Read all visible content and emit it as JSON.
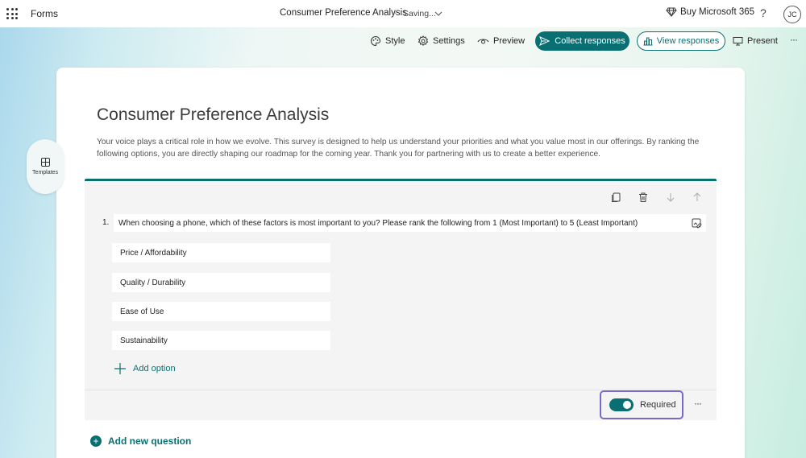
{
  "app": {
    "name": "Forms"
  },
  "document": {
    "title": "Consumer Preference Analysis",
    "separator": "-",
    "status": "Saving..."
  },
  "header": {
    "buy_label": "Buy Microsoft 365",
    "help_label": "?",
    "avatar_initials": "JC"
  },
  "toolbar": {
    "style_label": "Style",
    "settings_label": "Settings",
    "preview_label": "Preview",
    "collect_label": "Collect responses",
    "view_label": "View responses",
    "present_label": "Present",
    "more_label": "···"
  },
  "sidebar": {
    "templates_label": "Templates"
  },
  "form": {
    "title": "Consumer Preference Analysis",
    "description": "Your voice plays a critical role in how we evolve. This survey is designed to help us understand your priorities and what you value most in our offerings. By ranking the following options, you are directly shaping our roadmap for the coming year. Thank you for partnering with us to create a better experience."
  },
  "question": {
    "number": "1.",
    "text": "When choosing a phone, which of these factors is most important to you? Please rank the following from 1 (Most Important) to 5 (Least Important)",
    "options": [
      "Price / Affordability",
      "Quality / Durability",
      "Ease of Use",
      "Sustainability"
    ],
    "add_option_label": "Add option",
    "required_label": "Required",
    "required": true,
    "more_label": "···"
  },
  "add_question_label": "Add new question",
  "colors": {
    "accent": "#0a6f73",
    "focus_outline": "#7b68c9"
  }
}
